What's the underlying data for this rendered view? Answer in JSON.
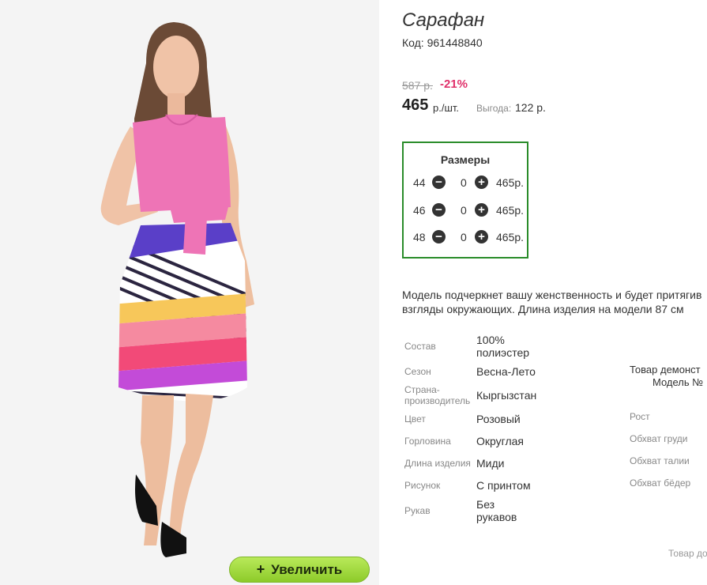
{
  "product": {
    "title": "Сарафан",
    "code_label": "Код:",
    "code": "961448840"
  },
  "price": {
    "old": "587 р.",
    "discount": "-21%",
    "current": "465",
    "unit": "р./шт.",
    "benefit_label": "Выгода:",
    "benefit_value": "122 р."
  },
  "sizes": {
    "title": "Размеры",
    "rows": [
      {
        "size": "44",
        "qty": "0",
        "price": "465р."
      },
      {
        "size": "46",
        "qty": "0",
        "price": "465р."
      },
      {
        "size": "48",
        "qty": "0",
        "price": "465р."
      }
    ]
  },
  "description": {
    "line1": "Модель подчеркнет вашу женственность и будет притягив",
    "line2": "взгляды окружающих. Длина изделия на модели 87 см"
  },
  "attributes": [
    {
      "label": "Состав",
      "value": "100% полиэстер"
    },
    {
      "label": "Сезон",
      "value": "Весна-Лето"
    },
    {
      "label": "Страна-производитель",
      "value": "Кыргызстан"
    },
    {
      "label": "Цвет",
      "value": "Розовый"
    },
    {
      "label": "Горловина",
      "value": "Округлая"
    },
    {
      "label": "Длина изделия",
      "value": "Миди"
    },
    {
      "label": "Рисунок",
      "value": "С принтом"
    },
    {
      "label": "Рукав",
      "value": "Без рукавов"
    }
  ],
  "model": {
    "line1": "Товар демонст",
    "line2": "Модель №",
    "measurements": [
      "Рост",
      "Обхват груди",
      "Обхват талии",
      "Обхват бёдер"
    ],
    "footnote": "Товар до"
  },
  "zoom": {
    "plus": "+",
    "label": "Увеличить"
  },
  "colors": {
    "accent_green": "#8dcb2a",
    "sizes_border": "#2a8c2a",
    "discount": "#e0306a"
  }
}
